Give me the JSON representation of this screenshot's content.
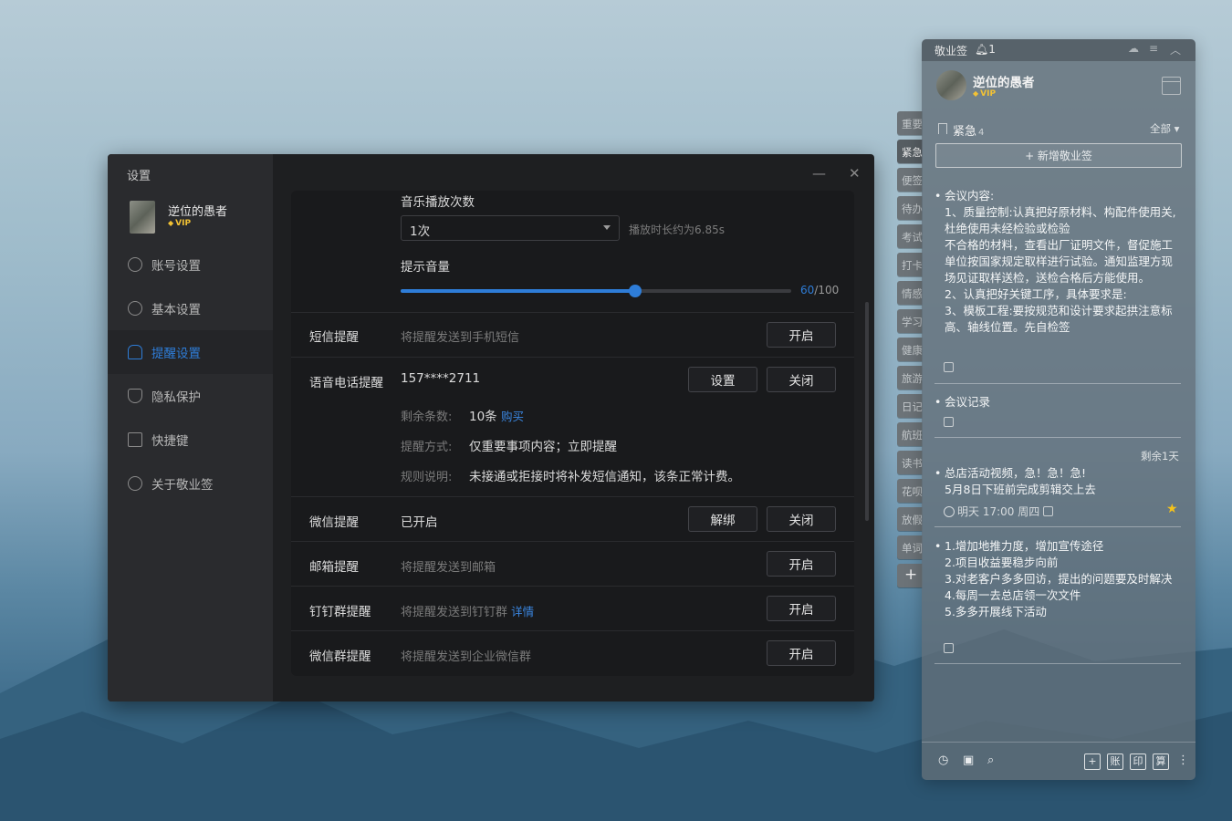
{
  "settings": {
    "title": "设置",
    "user": {
      "name": "逆位的愚者",
      "badge": "VIP"
    },
    "nav": [
      {
        "label": "账号设置",
        "icon": "user-icon",
        "active": false
      },
      {
        "label": "基本设置",
        "icon": "settings-icon",
        "active": false
      },
      {
        "label": "提醒设置",
        "icon": "bell-icon",
        "active": true
      },
      {
        "label": "隐私保护",
        "icon": "shield-icon",
        "active": false
      },
      {
        "label": "快捷键",
        "icon": "keyboard-icon",
        "active": false
      },
      {
        "label": "关于敬业签",
        "icon": "info-icon",
        "active": false
      }
    ],
    "window_controls": {
      "minimize": "—",
      "close": "✕"
    },
    "accent_color": "#2e7dd8",
    "music": {
      "label": "音乐播放次数",
      "selected": "1次",
      "duration_note": "播放时长约为6.85s"
    },
    "volume": {
      "label": "提示音量",
      "value": 60,
      "max": 100,
      "value_text": "60",
      "max_text": "/100"
    },
    "sms": {
      "label": "短信提醒",
      "desc": "将提醒发送到手机短信",
      "button": "开启"
    },
    "voice": {
      "label": "语音电话提醒",
      "phone": "157****2711",
      "btn_set": "设置",
      "btn_close": "关闭",
      "remaining_key": "剩余条数:",
      "remaining_val": "10条",
      "buy": "购买",
      "mode_key": "提醒方式:",
      "mode_val": "仅重要事项内容；立即提醒",
      "rule_key": "规则说明:",
      "rule_val": "未接通或拒接时将补发短信通知，该条正常计费。"
    },
    "wechat": {
      "label": "微信提醒",
      "status": "已开启",
      "btn_unbind": "解绑",
      "btn_close": "关闭"
    },
    "email": {
      "label": "邮箱提醒",
      "desc": "将提醒发送到邮箱",
      "button": "开启"
    },
    "dingtalk": {
      "label": "钉钉群提醒",
      "desc": "将提醒发送到钉钉群",
      "detail": "详情",
      "button": "开启"
    },
    "wecom": {
      "label": "微信群提醒",
      "desc": "将提醒发送到企业微信群",
      "button": "开启"
    }
  },
  "notes_panel": {
    "title": "敬业签",
    "bell_count": "1",
    "user": {
      "name": "逆位的愚者",
      "badge": "VIP"
    },
    "category": {
      "name": "紧急",
      "count": "4"
    },
    "filter": "全部 ▾",
    "new_note": "+ 新增敬业签",
    "side_tabs": [
      "重要",
      "紧急",
      "便签",
      "待办",
      "考试",
      "打卡",
      "情感",
      "学习",
      "健康",
      "旅游",
      "日记",
      "航班",
      "读书",
      "花呗",
      "放假",
      "单词"
    ],
    "add_tab": "+",
    "notes": [
      {
        "text": "会议内容:\n1、质量控制:认真把好原材料、构配件使用关,杜绝使用未经检验或检验\n不合格的材料，查看出厂证明文件，督促施工单位按国家规定取样进行试验。通知监理方现场见证取样送检，送检合格后方能使用。\n2、认真把好关键工序，具体要求是:\n3、模板工程:要按规范和设计要求起拱注意标高、轴线位置。先自检签"
      },
      {
        "text": "会议记录"
      },
      {
        "remaining": "剩余1天",
        "text": "总店活动视频，急！急！急!\n5月8日下班前完成剪辑交上去",
        "time": "明天 17:00 周四",
        "starred": true
      },
      {
        "text": "1.增加地推力度，增加宣传途径\n2.项目收益要稳步向前\n3.对老客户多多回访，提出的问题要及时解决\n4.每周一去总店领一次文件\n5.多多开展线下活动"
      }
    ],
    "footer_boxes": [
      "账",
      "印",
      "算"
    ]
  }
}
